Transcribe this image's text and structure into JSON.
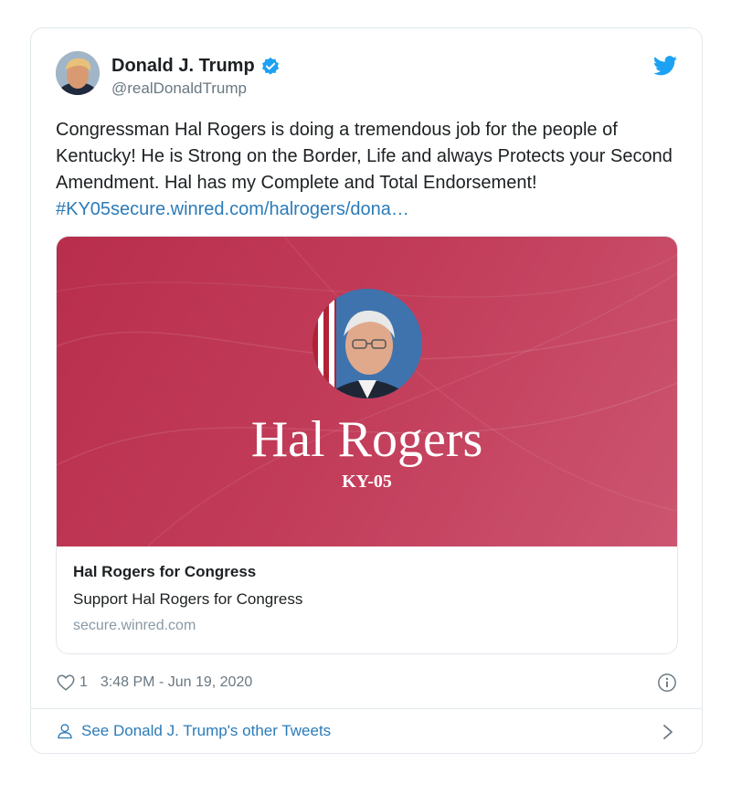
{
  "author": {
    "name": "Donald J. Trump",
    "handle": "@realDonaldTrump"
  },
  "tweet": {
    "text": "Congressman Hal Rogers is doing a tremendous job for the people of Kentucky! He is Strong on the Border, Life and always Protects your Second Amendment. Hal has my Complete and Total Endorsement!",
    "link": "#KY05secure.winred.com/halrogers/dona…"
  },
  "card": {
    "image_name": "Hal Rogers",
    "image_district": "KY-05",
    "title": "Hal Rogers for Congress",
    "description": "Support Hal Rogers for Congress",
    "domain": "secure.winred.com"
  },
  "meta": {
    "likes": "1",
    "timestamp": "3:48 PM - Jun 19, 2020"
  },
  "footer": {
    "see_more": "See Donald J. Trump's other Tweets"
  },
  "icons": {
    "verified": "verified-badge-icon",
    "brand": "twitter-bird-icon",
    "like": "heart-icon",
    "info": "info-icon",
    "profile": "person-icon",
    "next": "chevron-right-icon"
  },
  "colors": {
    "link": "#2b7bb9",
    "card_image": "#c23d5a",
    "secondary_text": "#697882",
    "border": "#e1e8ed"
  }
}
